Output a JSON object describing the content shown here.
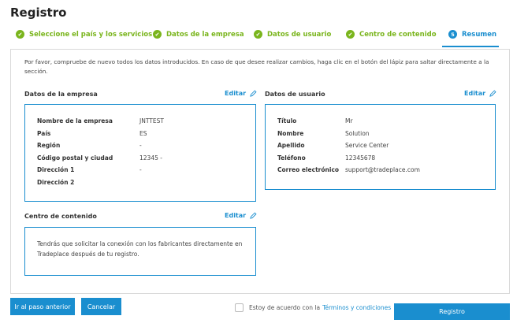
{
  "page": {
    "title": "Registro"
  },
  "steps": [
    {
      "label": "Seleccione el país y los servicios",
      "state": "done"
    },
    {
      "label": "Datos de la empresa",
      "state": "done"
    },
    {
      "label": "Datos de usuario",
      "state": "done"
    },
    {
      "label": "Centro de contenido",
      "state": "done"
    },
    {
      "label": "Resumen",
      "number": "5",
      "state": "active"
    }
  ],
  "intro": "Por favor, compruebe de nuevo todos los datos introducidos. En caso de que desee realizar cambios, haga clic en el botón del lápiz para saltar directamente a la sección.",
  "company": {
    "heading": "Datos de la empresa",
    "edit_label": "Editar",
    "rows": [
      {
        "key": "Nombre de la empresa",
        "value": "JNTTEST"
      },
      {
        "key": "País",
        "value": "ES"
      },
      {
        "key": "Región",
        "value": "-"
      },
      {
        "key": "Código postal y ciudad",
        "value": "12345 -"
      },
      {
        "key": "Dirección 1",
        "value": "-"
      },
      {
        "key": "Dirección 2",
        "value": ""
      }
    ]
  },
  "user": {
    "heading": "Datos de usuario",
    "edit_label": "Editar",
    "rows": [
      {
        "key": "Título",
        "value": "Mr"
      },
      {
        "key": "Nombre",
        "value": "Solution"
      },
      {
        "key": "Apellido",
        "value": "Service Center"
      },
      {
        "key": "Teléfono",
        "value": "12345678"
      },
      {
        "key": "Correo electrónico",
        "value": "support@tradeplace.com"
      }
    ]
  },
  "content_center": {
    "heading": "Centro de contenido",
    "edit_label": "Editar",
    "note": "Tendrás que solicitar la conexión con los fabricantes directamente en Tradeplace después de tu registro."
  },
  "footer": {
    "back_label": "Ir al paso anterior",
    "cancel_label": "Cancelar",
    "agree_text": "Estoy de acuerdo con la",
    "agree_link": "Términos y condiciones",
    "agree_checked": false,
    "submit_label": "Registro"
  },
  "colors": {
    "accent": "#1a8ecf",
    "done": "#7ab51d"
  }
}
